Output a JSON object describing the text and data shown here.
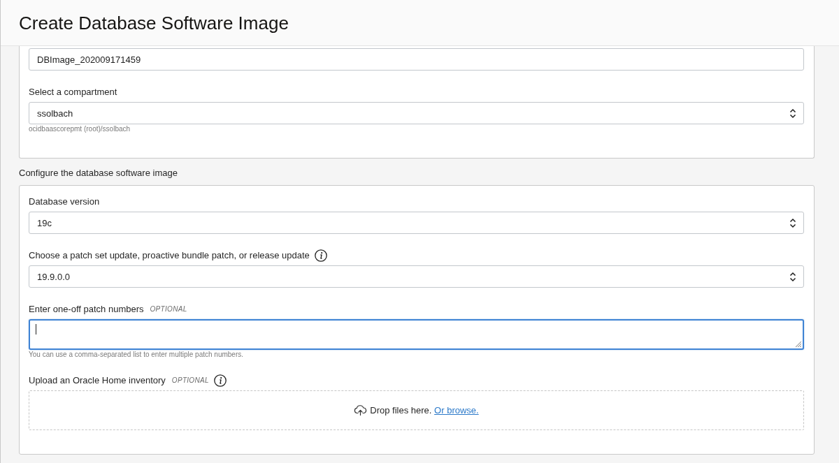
{
  "header": {
    "title": "Create Database Software Image"
  },
  "sections": [
    {
      "fields": [
        {
          "kind": "text",
          "value": "DBImage_202009171459",
          "focused": false
        },
        {
          "kind": "select",
          "label": "Select a compartment",
          "info": false,
          "value": "ssolbach",
          "hint": "ocidbaascorepmt (root)/ssolbach",
          "focused": false
        }
      ]
    },
    {
      "heading": "Configure the database software image",
      "fields": [
        {
          "kind": "select",
          "label": "Database version",
          "info": false,
          "value": "19c",
          "focused": false
        },
        {
          "kind": "select",
          "label": "Choose a patch set update, proactive bundle patch, or release update",
          "info": true,
          "value": "19.9.0.0",
          "focused": false
        },
        {
          "kind": "textarea",
          "label": "Enter one-off patch numbers",
          "optional_tag": "OPTIONAL",
          "info": false,
          "focused": true,
          "hint": "You can use a comma-separated list to enter multiple patch numbers."
        },
        {
          "kind": "upload",
          "label": "Upload an Oracle Home inventory",
          "optional_tag": "OPTIONAL",
          "info": true,
          "focused": false,
          "drop_text": "Drop files here.",
          "browse_link": "Or browse."
        }
      ]
    }
  ]
}
